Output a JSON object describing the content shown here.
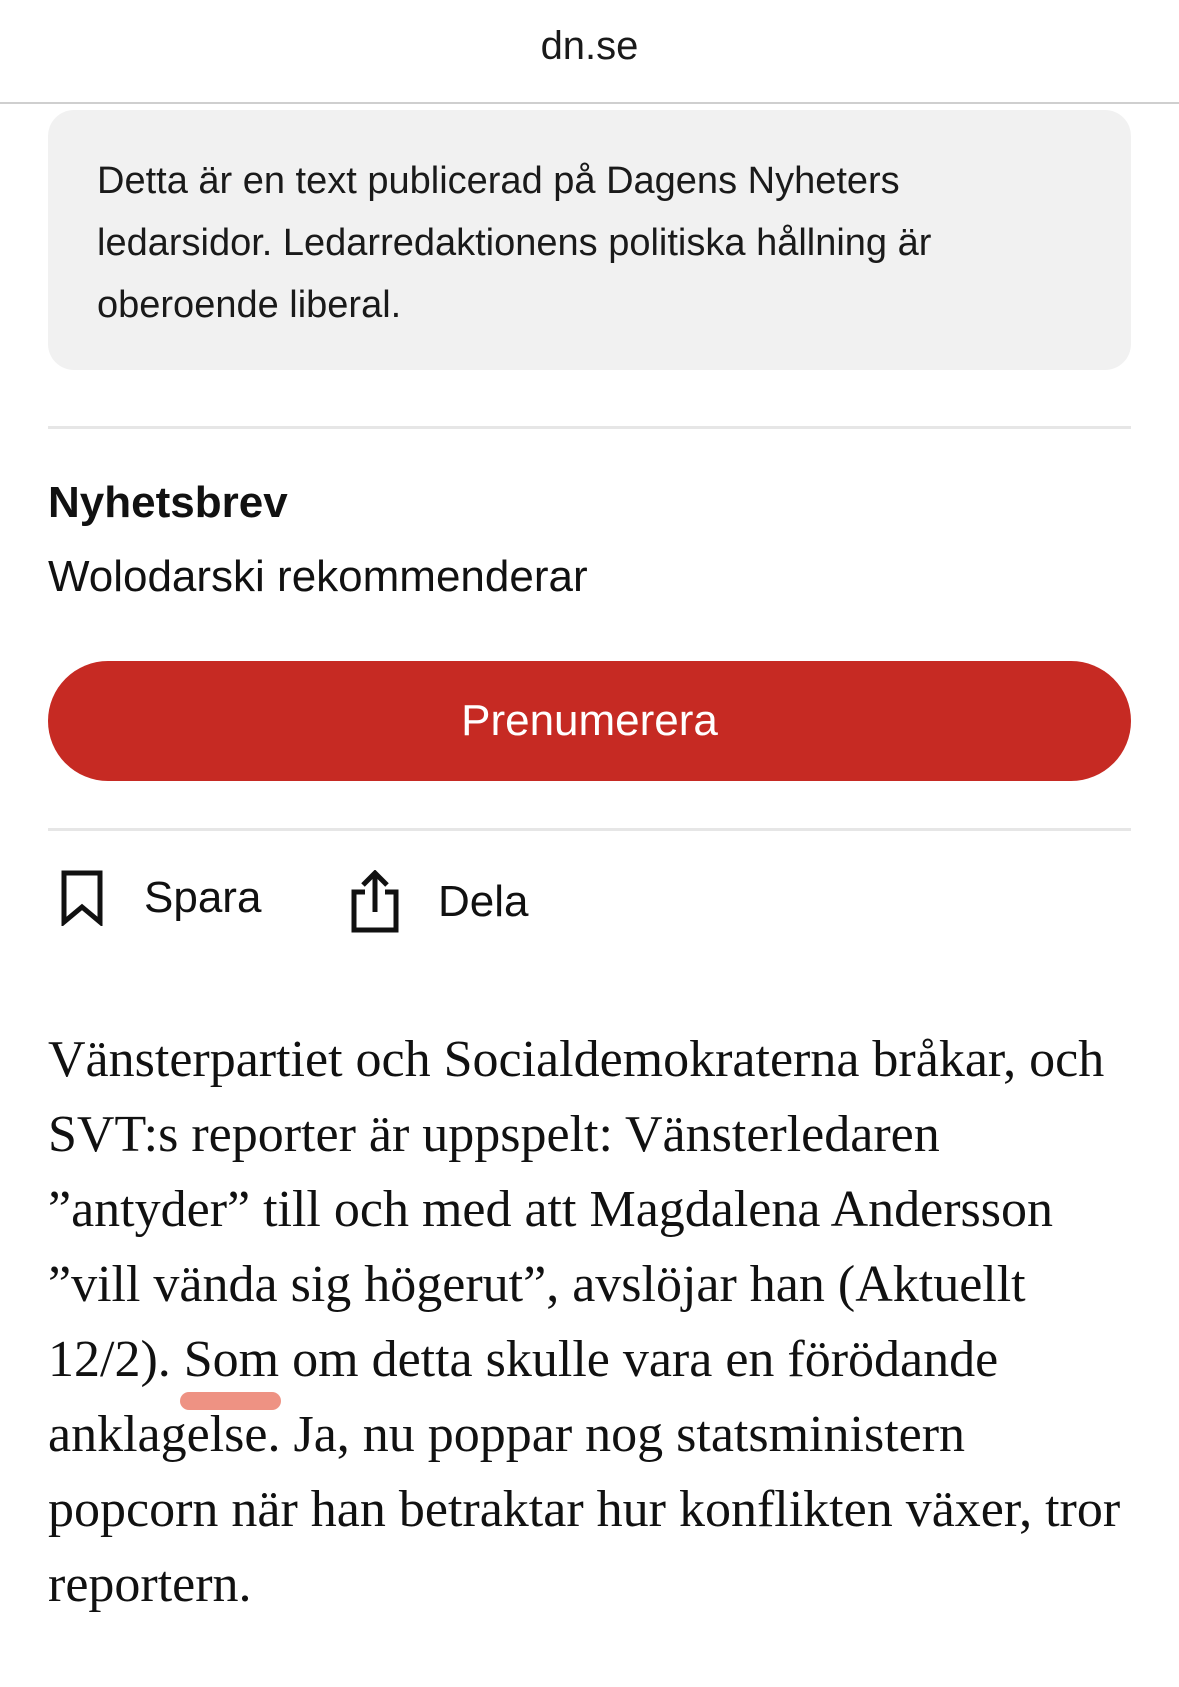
{
  "browser": {
    "domain": "dn.se"
  },
  "notice": {
    "text": "Detta är en text publicerad på Dagens Nyheters ledarsidor. Ledarredaktionens politiska hållning är oberoende liberal."
  },
  "newsletter": {
    "title": "Nyhetsbrev",
    "subtitle": "Wolodarski rekommenderar",
    "subscribe_label": "Prenumerera"
  },
  "actions": {
    "save_label": "Spara",
    "share_label": "Dela"
  },
  "article": {
    "before_highlight": "Vänsterpartiet och Socialdemokraterna bråkar, och SVT:s reporter är uppspelt: Vänsterledaren ”antyder” till och med att Magdalena Andersson ”vill vända sig högerut”, avslöjar han (Aktuellt 12/2). ",
    "highlight": "Som om detta skulle vara en förödande anklagelse",
    "after_highlight": ". Ja, nu poppar nog statsministern popcorn när han betraktar hur konflikten växer, tror reportern."
  },
  "colors": {
    "accent": "#c62a23",
    "notice_bg": "#f1f1f1",
    "highlight": "#e86e5a"
  },
  "icons": [
    "bookmark-icon",
    "share-icon"
  ]
}
